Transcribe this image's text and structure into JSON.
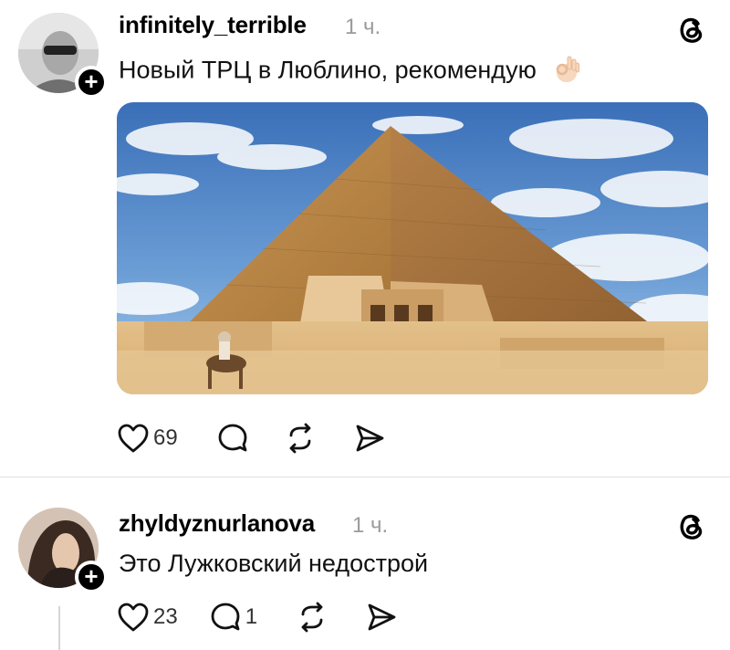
{
  "posts": [
    {
      "username": "infinitely_terrible",
      "time": "1 ч.",
      "text": "Новый ТРЦ в Люблино, рекомендую",
      "emoji_icon": "ok-hand-icon",
      "likes": "69",
      "replies": "",
      "reposts": ""
    },
    {
      "username": "zhyldyznurlanova",
      "time": "1 ч.",
      "text": "Это Лужковский недострой",
      "likes": "23",
      "replies": "1",
      "reposts": ""
    }
  ],
  "colors": {
    "text": "#000000",
    "muted": "#9b9b9b",
    "divider": "#e0e0e0"
  }
}
